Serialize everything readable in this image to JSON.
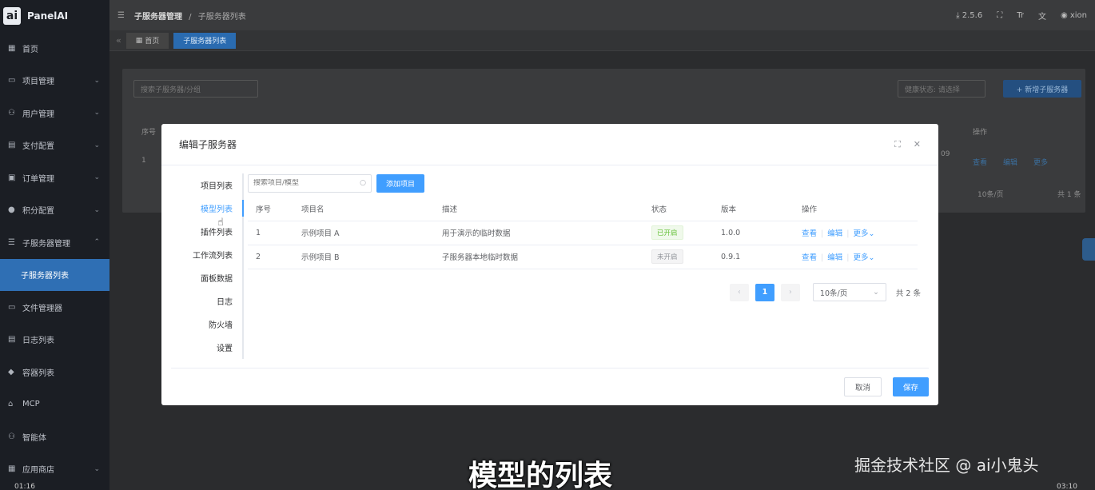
{
  "brand": {
    "logo": "ai",
    "name": "PanelAI"
  },
  "sidebar": {
    "items": [
      {
        "icon": "▦",
        "label": "首页"
      },
      {
        "icon": "▭",
        "label": "项目管理",
        "arrow": "⌄"
      },
      {
        "icon": "⚇",
        "label": "用户管理",
        "arrow": "⌄"
      },
      {
        "icon": "▤",
        "label": "支付配置",
        "arrow": "⌄"
      },
      {
        "icon": "▣",
        "label": "订单管理",
        "arrow": "⌄"
      },
      {
        "icon": "●",
        "label": "积分配置",
        "arrow": "⌄"
      },
      {
        "icon": "☰",
        "label": "子服务器管理",
        "arrow": "⌃"
      },
      {
        "icon": "",
        "label": "子服务器列表"
      },
      {
        "icon": "▭",
        "label": "文件管理器"
      },
      {
        "icon": "▤",
        "label": "日志列表"
      },
      {
        "icon": "◆",
        "label": "容器列表"
      },
      {
        "icon": "⌂",
        "label": "MCP"
      },
      {
        "icon": "⚇",
        "label": "智能体"
      },
      {
        "icon": "▦",
        "label": "应用商店",
        "arrow": "⌄"
      }
    ]
  },
  "topbar": {
    "breadcrumb_root": "子服务器管理",
    "breadcrumb_sep": "/",
    "breadcrumb_current": "子服务器列表",
    "version": "2.5.6",
    "user": "xion"
  },
  "tabs": [
    {
      "label": "首页"
    },
    {
      "label": "子服务器列表"
    }
  ],
  "background_page": {
    "search_placeholder": "搜索子服务器/分组",
    "health_filter": "健康状态: 请选择",
    "add_button": "+ 新增子服务器",
    "col_index": "序号",
    "col_ops": "操作",
    "row_index": "1",
    "row_fragment": "09",
    "op_view": "查看",
    "op_edit": "编辑",
    "op_more": "更多",
    "page_size": "10条/页",
    "total": "共 1 条"
  },
  "modal": {
    "title": "编辑子服务器",
    "nav": [
      "项目列表",
      "模型列表",
      "插件列表",
      "工作流列表",
      "面板数据",
      "日志",
      "防火墙",
      "设置"
    ],
    "active_nav": 1,
    "search_placeholder": "搜索项目/模型",
    "add_button": "添加项目",
    "columns": [
      "序号",
      "项目名",
      "描述",
      "状态",
      "版本",
      "操作"
    ],
    "rows": [
      {
        "index": "1",
        "name": "示例项目 A",
        "desc": "用于演示的临时数据",
        "status": "已开启",
        "status_on": true,
        "version": "1.0.0"
      },
      {
        "index": "2",
        "name": "示例项目 B",
        "desc": "子服务器本地临时数据",
        "status": "未开启",
        "status_on": false,
        "version": "0.9.1"
      }
    ],
    "op_view": "查看",
    "op_edit": "编辑",
    "op_more": "更多",
    "pagination": {
      "prev": "‹",
      "current": "1",
      "next": "›",
      "page_size": "10条/页",
      "total": "共 2 条"
    },
    "cancel": "取消",
    "save": "保存"
  },
  "overlay": {
    "subtitle": "模型的列表",
    "watermark": "掘金技术社区 @ ai小鬼头",
    "time_left": "01:16",
    "time_right": "03:10"
  },
  "colors": {
    "primary": "#409eff",
    "success": "#67c23a",
    "sidebar_bg": "#1b1e24",
    "sidebar_active": "#2f6fb4"
  }
}
